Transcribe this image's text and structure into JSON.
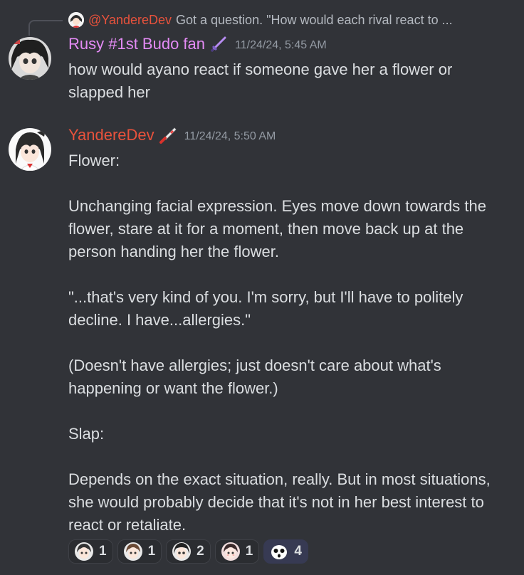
{
  "reply": {
    "author": "@YandereDev",
    "text": "Got a question. \"How would each rival react to ..."
  },
  "messages": [
    {
      "username": "Rusy #1st Budo fan",
      "username_color": "#e48bf5",
      "role_icon": "purple-sword-icon",
      "timestamp": "11/24/24, 5:45 AM",
      "lines": [
        "how would ayano react if someone gave her a flower or",
        "slapped her"
      ]
    },
    {
      "username": "YandereDev",
      "username_color": "#e8523c",
      "role_icon": "red-knife-icon",
      "timestamp": "11/24/24, 5:50 AM",
      "paragraphs": [
        "Flower:",
        "",
        "Unchanging facial expression. Eyes move down towards the flower, stare at it for a moment, then move back up at the person handing her the flower.",
        "",
        "\"...that's very kind of you. I'm sorry, but I'll have to politely decline. I have...allergies.\"",
        "",
        "(Doesn't have allergies; just doesn't care about what's happening or want the flower.)",
        "",
        "Slap:",
        "",
        "Depends on the exact situation, really. But in most situations, she would probably decide that it's not in her best interest to react or retaliate."
      ]
    }
  ],
  "reactions": [
    {
      "emoji": "anime-girl-face-emoji",
      "count": "1"
    },
    {
      "emoji": "anime-brown-hair-emoji",
      "count": "1"
    },
    {
      "emoji": "anime-dark-hair-emoji",
      "count": "2"
    },
    {
      "emoji": "anime-pink-face-emoji",
      "count": "1"
    },
    {
      "emoji": "shocked-face-emoji",
      "count": "4"
    }
  ],
  "colors": {
    "background": "#313338",
    "text": "#dbdee1",
    "muted": "#949ba4",
    "reaction_bg": "#2b2d31",
    "reaction_active": "#373a53"
  }
}
